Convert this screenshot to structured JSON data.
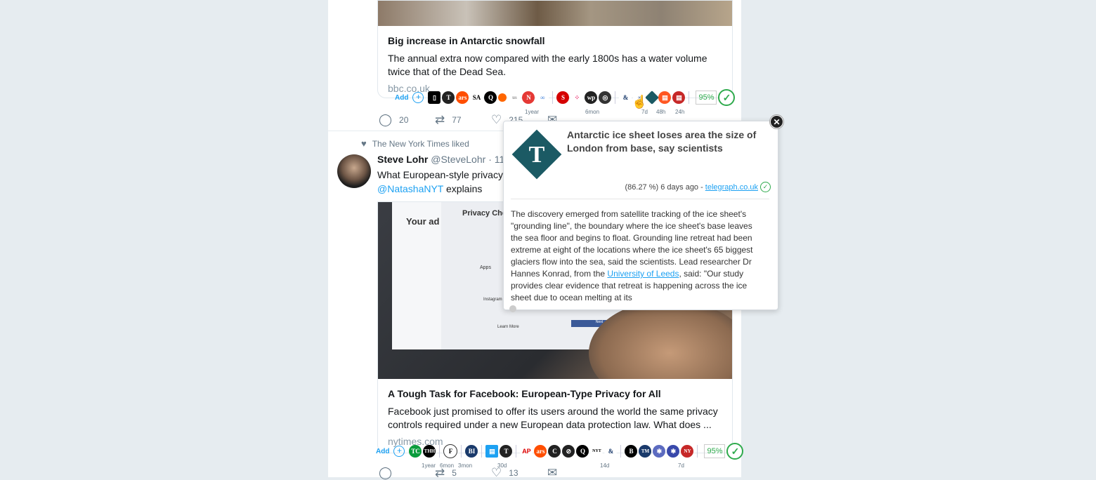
{
  "tweet1": {
    "card": {
      "title": "Big increase in Antarctic snowfall",
      "description": "The annual extra now compared with the early 1800s has a water volume twice that of the Dead Sea.",
      "domain": "bbc.co.uk"
    },
    "toolbar": {
      "add_label": "Add",
      "score": "95%",
      "sources": [
        "N",
        "T",
        "ars",
        "SA",
        "Q",
        "ht",
        "C",
        "N",
        "∞",
        "S",
        "⁘",
        "wp",
        "O",
        "Z",
        "∞",
        "T",
        "A",
        "N",
        "1"
      ],
      "ages": [
        "1year",
        "6mon",
        "7d",
        "48h",
        "24h"
      ]
    },
    "actions": {
      "replies": "20",
      "retweets": "77",
      "likes": "215"
    }
  },
  "tweet2": {
    "liked_by": "The New York Times liked",
    "author_name": "Steve Lohr",
    "author_handle": "@SteveLohr",
    "time": "· 11h",
    "text": "What European-style privacy rules could mean for Facebook",
    "mention": "@NatashaNYT",
    "text_suffix": " explains",
    "card": {
      "title": "A Tough Task for Facebook: European-Type Privacy for All",
      "description": "Facebook just promised to offer its users around the world the same privacy controls required under a new European data protection law. What does ...",
      "domain": "nytimes.com",
      "image_labels": {
        "ad_title": "Your ad",
        "privacy": "Privacy Checkup",
        "apps": "Apps",
        "instagram": "Instagram",
        "learn_more": "Learn More",
        "next": "Next"
      }
    },
    "toolbar": {
      "add_label": "Add",
      "score": "95%",
      "sources": [
        "TC",
        "THH",
        "F",
        "BI",
        "T",
        "AP",
        "ars",
        "C",
        "S",
        "Q",
        "S",
        "B",
        "T",
        "N",
        "N"
      ],
      "ages": [
        "1year",
        "6mon",
        "3mon",
        "30d",
        "14d",
        "7d"
      ]
    },
    "actions": {
      "replies": "",
      "retweets": "5",
      "likes": "13"
    }
  },
  "popup": {
    "title": "Antarctic ice sheet loses area the size of London from base, say scientists",
    "score_text": "(86.27 %) 6 days ago - ",
    "source_link": "telegraph.co.uk",
    "body_pre": "The discovery emerged from satellite tracking of the ice sheet's \"grounding line\", the boundary where the ice sheet's base leaves the sea floor and begins to float. Grounding line retreat had been extreme at eight of the locations where the ice sheet's 65 biggest glaciers flow into the sea, said the scientists. Lead researcher Dr Hannes Konrad, from the ",
    "body_link": "University of Leeds",
    "body_post": ", said: \"Our study provides clear evidence that retreat is happening across the ice sheet due to ocean melting at its"
  },
  "colors": {
    "accent": "#1da1f2",
    "check": "#2eaa4c",
    "telegraph": "#1b5a64"
  }
}
